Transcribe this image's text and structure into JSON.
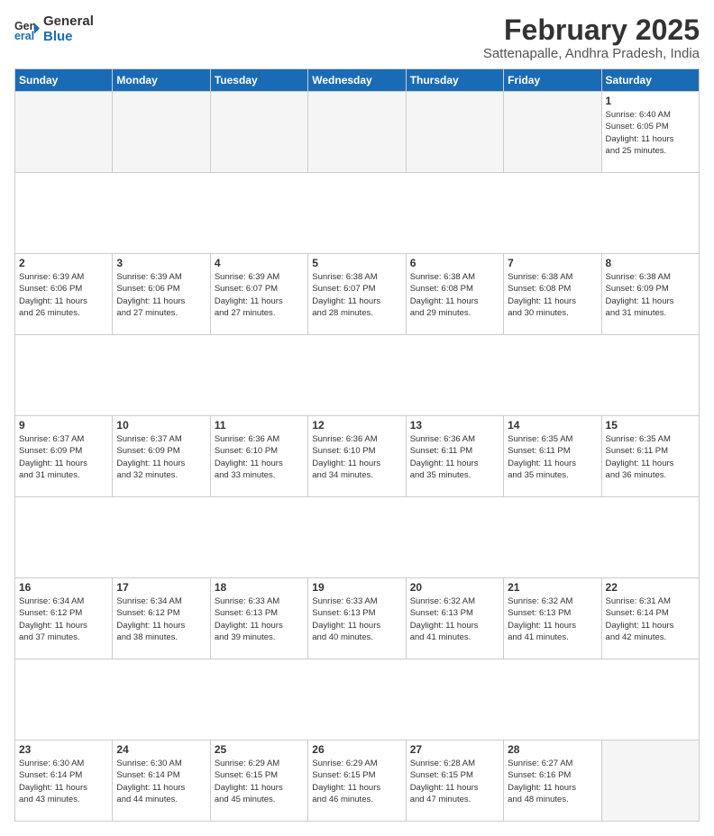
{
  "logo": {
    "line1": "General",
    "line2": "Blue"
  },
  "title": "February 2025",
  "location": "Sattenapalle, Andhra Pradesh, India",
  "days_of_week": [
    "Sunday",
    "Monday",
    "Tuesday",
    "Wednesday",
    "Thursday",
    "Friday",
    "Saturday"
  ],
  "weeks": [
    [
      {
        "num": "",
        "info": ""
      },
      {
        "num": "",
        "info": ""
      },
      {
        "num": "",
        "info": ""
      },
      {
        "num": "",
        "info": ""
      },
      {
        "num": "",
        "info": ""
      },
      {
        "num": "",
        "info": ""
      },
      {
        "num": "1",
        "info": "Sunrise: 6:40 AM\nSunset: 6:05 PM\nDaylight: 11 hours\nand 25 minutes."
      }
    ],
    [
      {
        "num": "2",
        "info": "Sunrise: 6:39 AM\nSunset: 6:06 PM\nDaylight: 11 hours\nand 26 minutes."
      },
      {
        "num": "3",
        "info": "Sunrise: 6:39 AM\nSunset: 6:06 PM\nDaylight: 11 hours\nand 27 minutes."
      },
      {
        "num": "4",
        "info": "Sunrise: 6:39 AM\nSunset: 6:07 PM\nDaylight: 11 hours\nand 27 minutes."
      },
      {
        "num": "5",
        "info": "Sunrise: 6:38 AM\nSunset: 6:07 PM\nDaylight: 11 hours\nand 28 minutes."
      },
      {
        "num": "6",
        "info": "Sunrise: 6:38 AM\nSunset: 6:08 PM\nDaylight: 11 hours\nand 29 minutes."
      },
      {
        "num": "7",
        "info": "Sunrise: 6:38 AM\nSunset: 6:08 PM\nDaylight: 11 hours\nand 30 minutes."
      },
      {
        "num": "8",
        "info": "Sunrise: 6:38 AM\nSunset: 6:09 PM\nDaylight: 11 hours\nand 31 minutes."
      }
    ],
    [
      {
        "num": "9",
        "info": "Sunrise: 6:37 AM\nSunset: 6:09 PM\nDaylight: 11 hours\nand 31 minutes."
      },
      {
        "num": "10",
        "info": "Sunrise: 6:37 AM\nSunset: 6:09 PM\nDaylight: 11 hours\nand 32 minutes."
      },
      {
        "num": "11",
        "info": "Sunrise: 6:36 AM\nSunset: 6:10 PM\nDaylight: 11 hours\nand 33 minutes."
      },
      {
        "num": "12",
        "info": "Sunrise: 6:36 AM\nSunset: 6:10 PM\nDaylight: 11 hours\nand 34 minutes."
      },
      {
        "num": "13",
        "info": "Sunrise: 6:36 AM\nSunset: 6:11 PM\nDaylight: 11 hours\nand 35 minutes."
      },
      {
        "num": "14",
        "info": "Sunrise: 6:35 AM\nSunset: 6:11 PM\nDaylight: 11 hours\nand 35 minutes."
      },
      {
        "num": "15",
        "info": "Sunrise: 6:35 AM\nSunset: 6:11 PM\nDaylight: 11 hours\nand 36 minutes."
      }
    ],
    [
      {
        "num": "16",
        "info": "Sunrise: 6:34 AM\nSunset: 6:12 PM\nDaylight: 11 hours\nand 37 minutes."
      },
      {
        "num": "17",
        "info": "Sunrise: 6:34 AM\nSunset: 6:12 PM\nDaylight: 11 hours\nand 38 minutes."
      },
      {
        "num": "18",
        "info": "Sunrise: 6:33 AM\nSunset: 6:13 PM\nDaylight: 11 hours\nand 39 minutes."
      },
      {
        "num": "19",
        "info": "Sunrise: 6:33 AM\nSunset: 6:13 PM\nDaylight: 11 hours\nand 40 minutes."
      },
      {
        "num": "20",
        "info": "Sunrise: 6:32 AM\nSunset: 6:13 PM\nDaylight: 11 hours\nand 41 minutes."
      },
      {
        "num": "21",
        "info": "Sunrise: 6:32 AM\nSunset: 6:13 PM\nDaylight: 11 hours\nand 41 minutes."
      },
      {
        "num": "22",
        "info": "Sunrise: 6:31 AM\nSunset: 6:14 PM\nDaylight: 11 hours\nand 42 minutes."
      }
    ],
    [
      {
        "num": "23",
        "info": "Sunrise: 6:30 AM\nSunset: 6:14 PM\nDaylight: 11 hours\nand 43 minutes."
      },
      {
        "num": "24",
        "info": "Sunrise: 6:30 AM\nSunset: 6:14 PM\nDaylight: 11 hours\nand 44 minutes."
      },
      {
        "num": "25",
        "info": "Sunrise: 6:29 AM\nSunset: 6:15 PM\nDaylight: 11 hours\nand 45 minutes."
      },
      {
        "num": "26",
        "info": "Sunrise: 6:29 AM\nSunset: 6:15 PM\nDaylight: 11 hours\nand 46 minutes."
      },
      {
        "num": "27",
        "info": "Sunrise: 6:28 AM\nSunset: 6:15 PM\nDaylight: 11 hours\nand 47 minutes."
      },
      {
        "num": "28",
        "info": "Sunrise: 6:27 AM\nSunset: 6:16 PM\nDaylight: 11 hours\nand 48 minutes."
      },
      {
        "num": "",
        "info": ""
      }
    ]
  ]
}
